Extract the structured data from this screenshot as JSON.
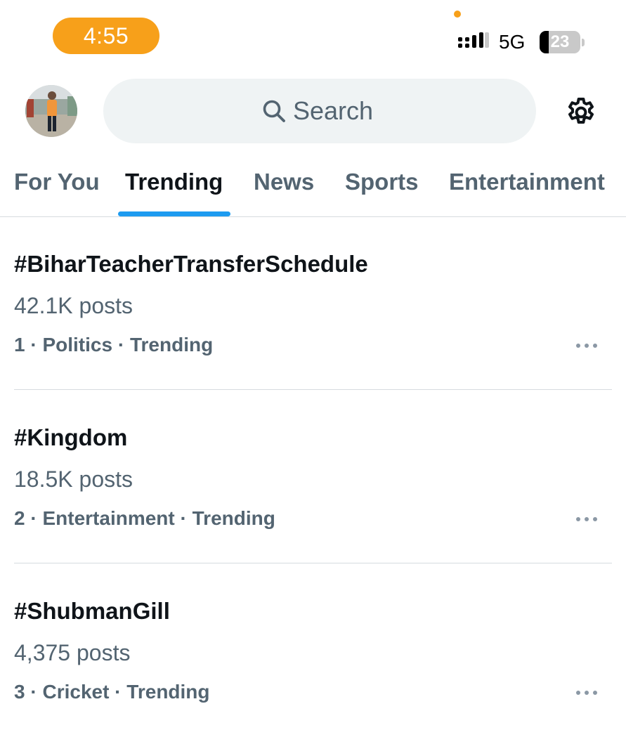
{
  "status_bar": {
    "time": "4:55",
    "network": "5G",
    "battery_level": "23",
    "battery_fraction": 0.23,
    "accent_color": "#f7a01a"
  },
  "header": {
    "avatar_icon": "profile-photo",
    "search": {
      "placeholder": "Search",
      "icon": "search-icon"
    },
    "settings_icon": "gear-icon"
  },
  "tabs": [
    {
      "label": "For You",
      "active": false
    },
    {
      "label": "Trending",
      "active": true
    },
    {
      "label": "News",
      "active": false
    },
    {
      "label": "Sports",
      "active": false
    },
    {
      "label": "Entertainment",
      "active": false
    }
  ],
  "tab_accent_color": "#1d9bf0",
  "trends": [
    {
      "hashtag": "#BiharTeacherTransferSchedule",
      "posts": "42.1K posts",
      "rank": "1",
      "category": "Politics",
      "status": "Trending",
      "more_icon": "more-horizontal-icon"
    },
    {
      "hashtag": "#Kingdom",
      "posts": "18.5K posts",
      "rank": "2",
      "category": "Entertainment",
      "status": "Trending",
      "more_icon": "more-horizontal-icon"
    },
    {
      "hashtag": "#ShubmanGill",
      "posts": "4,375 posts",
      "rank": "3",
      "category": "Cricket",
      "status": "Trending",
      "more_icon": "more-horizontal-icon"
    }
  ]
}
